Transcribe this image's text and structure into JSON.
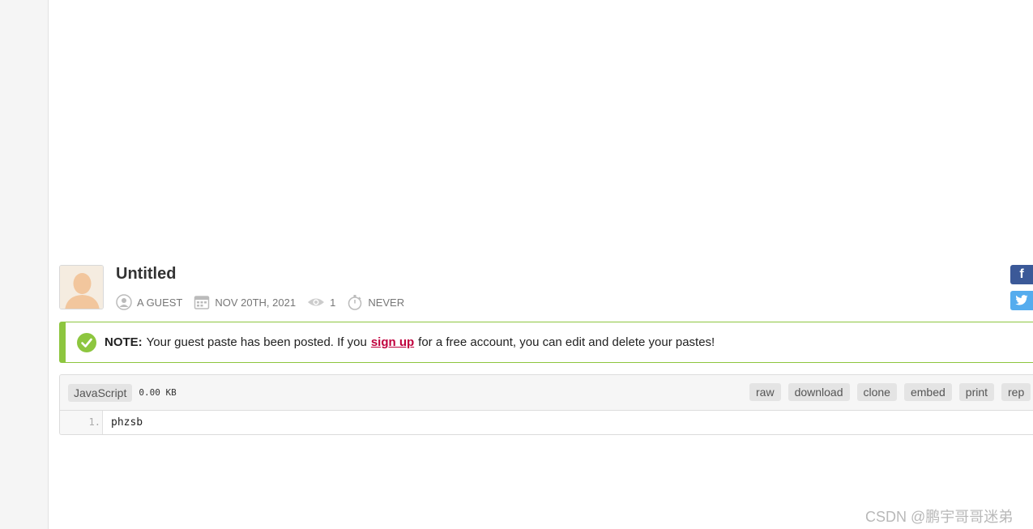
{
  "paste": {
    "title": "Untitled",
    "author": "A GUEST",
    "date": "NOV 20TH, 2021",
    "views": "1",
    "expiration": "NEVER"
  },
  "social": {
    "facebook_label": "f",
    "twitter_label": "t"
  },
  "notice": {
    "strong": "NOTE:",
    "before_link": "Your guest paste has been posted. If you",
    "link": "sign up",
    "after_link": "for a free account, you can edit and delete your pastes!",
    "accent_color": "#8dc63f"
  },
  "code_box": {
    "language": "JavaScript",
    "size": "0.00 KB",
    "actions": [
      "raw",
      "download",
      "clone",
      "embed",
      "print",
      "rep"
    ],
    "lines": [
      {
        "number": "1.",
        "text": "phzsb"
      }
    ]
  },
  "watermark": "CSDN @鹏宇哥哥迷弟",
  "colors": {
    "link": "#c0003d",
    "facebook": "#3b5998",
    "twitter": "#55acee"
  }
}
